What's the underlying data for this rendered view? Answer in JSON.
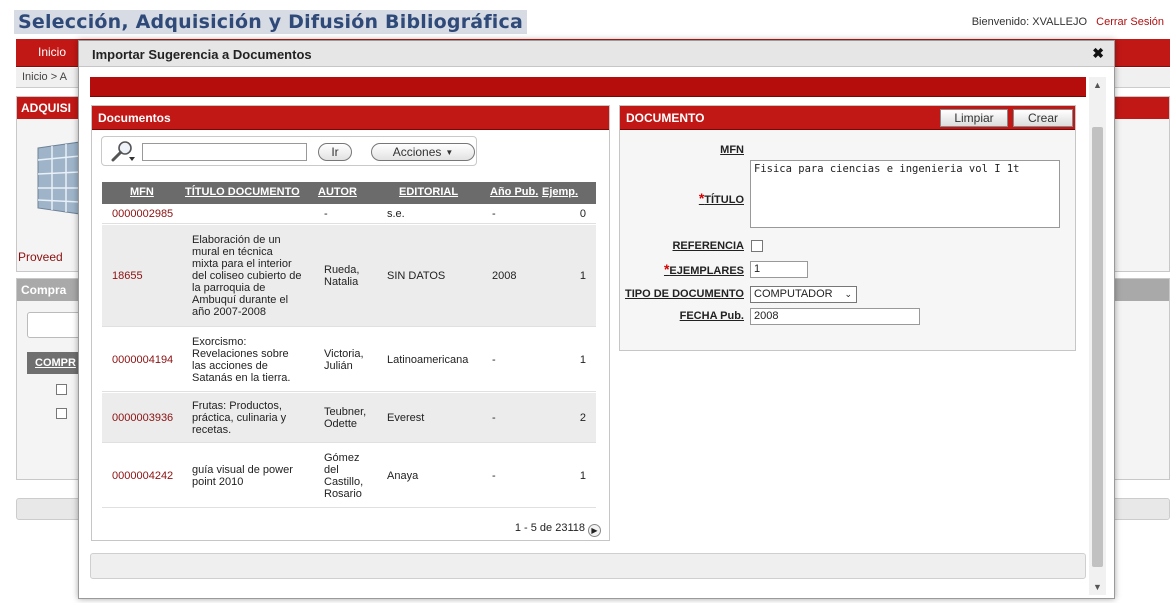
{
  "app": {
    "title": "Selección, Adquisición y Difusión Bibliográfica",
    "welcome": "Bienvenido: XVALLEJO",
    "logout": "Cerrar Sesión"
  },
  "background": {
    "nav_item": "Inicio",
    "breadcrumb": "Inicio  >  A",
    "panel1_title": "ADQUISI",
    "panel1_link": "Proveed",
    "panel2_title": "Compra",
    "panel2_col": "COMPR"
  },
  "modal": {
    "title": "Importar Sugerencia a Documentos",
    "close": "✖"
  },
  "docs": {
    "title": "Documentos",
    "search_placeholder": "",
    "go_label": "Ir",
    "actions_label": "Acciones",
    "columns": {
      "mfn": "MFN",
      "titulo": "TÍTULO DOCUMENTO",
      "autor": "AUTOR",
      "editorial": "EDITORIAL",
      "anio": "Año Pub.",
      "ejemp": "Ejemp."
    },
    "rows": [
      {
        "mfn": "0000002985",
        "titulo": "",
        "autor": "-",
        "editorial": "s.e.",
        "anio": "-",
        "ejemp": "0"
      },
      {
        "mfn": "18655",
        "titulo": "Elaboración de un mural en técnica mixta para el interior del coliseo cubierto de la parroquia de Ambuquí durante el año 2007-2008",
        "autor": "Rueda, Natalia",
        "editorial": "SIN DATOS",
        "anio": "2008",
        "ejemp": "1"
      },
      {
        "mfn": "0000004194",
        "titulo": "Exorcismo: Revelaciones sobre las acciones de Satanás en la tierra.",
        "autor": "Victoria, Julián",
        "editorial": "Latinoamericana",
        "anio": "-",
        "ejemp": "1"
      },
      {
        "mfn": "0000003936",
        "titulo": "Frutas: Productos, práctica, culinaria y recetas.",
        "autor": "Teubner, Odette",
        "editorial": "Everest",
        "anio": "-",
        "ejemp": "2"
      },
      {
        "mfn": "0000004242",
        "titulo": "guía visual de power point 2010",
        "autor": "Gómez del Castillo, Rosario",
        "editorial": "Anaya",
        "anio": "-",
        "ejemp": "1"
      }
    ],
    "pager": "1 - 5 de 23118"
  },
  "form": {
    "title": "DOCUMENTO",
    "clear_label": "Limpiar",
    "create_label": "Crear",
    "mfn_label": "MFN",
    "titulo_label": "TÍTULO",
    "titulo_value": "Fisica para ciencias e ingenieria vol I   1t",
    "referencia_label": "REFERENCIA",
    "ejemplares_label": "EJEMPLARES",
    "ejemplares_value": "1",
    "tipo_label": "TIPO DE DOCUMENTO",
    "tipo_value": "COMPUTADOR",
    "fecha_label": "FECHA Pub.",
    "fecha_value": "2008",
    "required_mark": "*"
  },
  "colors": {
    "accent_red": "#c11815",
    "header_grey": "#6b6b6b",
    "link_red": "#8b1111"
  }
}
